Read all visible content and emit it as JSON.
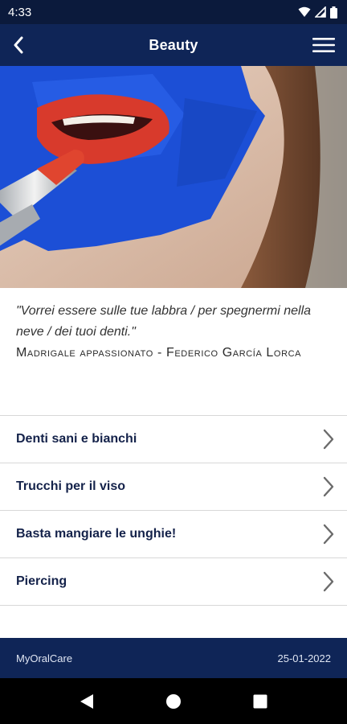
{
  "status_bar": {
    "time": "4:33"
  },
  "header": {
    "title": "Beauty"
  },
  "quote": {
    "text": "\"Vorrei essere sulle tue labbra / per spegnermi nella neve / dei tuoi denti.\"",
    "source": "Madrigale appassionato - Federico García Lorca"
  },
  "menu": {
    "items": [
      {
        "label": "Denti sani e bianchi"
      },
      {
        "label": "Trucchi per il viso"
      },
      {
        "label": "Basta mangiare le unghie!"
      },
      {
        "label": "Piercing"
      }
    ]
  },
  "footer": {
    "app_name": "MyOralCare",
    "date": "25-01-2022"
  },
  "colors": {
    "header_bg": "#0f2557",
    "status_bg": "#0b1a3c",
    "label_text": "#14224a",
    "tape_blue": "#1c4fd6",
    "lipstick_red": "#d83a2c"
  },
  "icons": {
    "back": "chevron-left-icon",
    "menu": "hamburger-menu-icon",
    "row": "chevron-right-icon"
  }
}
